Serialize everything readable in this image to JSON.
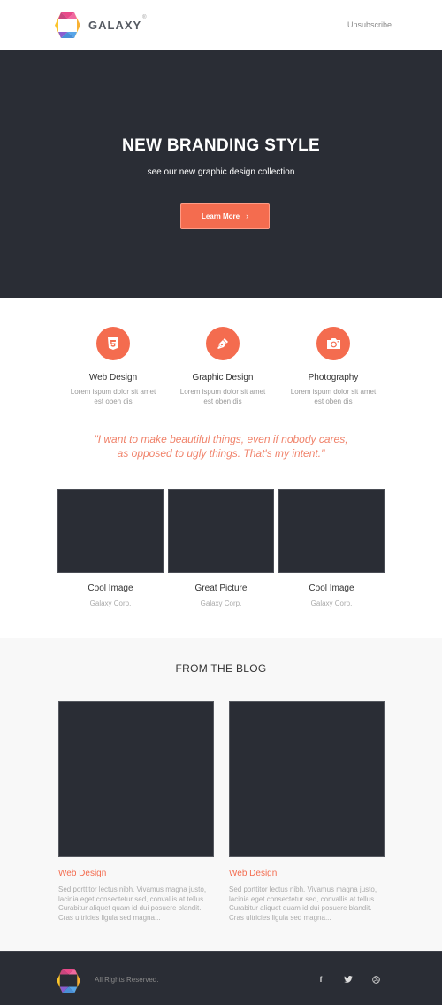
{
  "header": {
    "brand": "GALAXY",
    "brand_mark": "®",
    "unsubscribe_label": "Unsubscribe"
  },
  "hero": {
    "title": "NEW BRANDING STYLE",
    "subtitle": "see our new graphic design collection",
    "button_label": "Learn More",
    "button_icon": "chevron-right-icon",
    "chevron": "›"
  },
  "features": [
    {
      "icon": "html5-icon",
      "title": "Web Design",
      "desc_line1": "Lorem ispum dolor sit amet",
      "desc_line2": "est oben dis"
    },
    {
      "icon": "pen-nib-icon",
      "title": "Graphic Design",
      "desc_line1": "Lorem ispum dolor sit amet",
      "desc_line2": "est oben dis"
    },
    {
      "icon": "camera-icon",
      "title": "Photography",
      "desc_line1": "Lorem ispum dolor sit amet",
      "desc_line2": "est oben dis"
    }
  ],
  "quote": {
    "line1": "\"I want to make beautiful things, even if nobody cares,",
    "line2": "as opposed to ugly things. That's my intent.\""
  },
  "gallery": [
    {
      "title": "Cool Image",
      "subtitle": "Galaxy Corp."
    },
    {
      "title": "Great Picture",
      "subtitle": "Galaxy Corp."
    },
    {
      "title": "Cool Image",
      "subtitle": "Galaxy Corp."
    }
  ],
  "blog": {
    "title": "FROM THE BLOG",
    "posts": [
      {
        "title": "Web Design",
        "line1": "Sed porttitor lectus nibh. Vivamus magna justo,",
        "line2": "lacinia eget consectetur sed, convallis at tellus.",
        "line3": "Curabitur aliquet quam id dui posuere blandit.",
        "line4": "Cras ultricies ligula sed magna..."
      },
      {
        "title": "Web Design",
        "line1": "Sed porttitor lectus nibh. Vivamus magna justo,",
        "line2": "lacinia eget consectetur sed, convallis at tellus.",
        "line3": "Curabitur aliquet quam id dui posuere blandit.",
        "line4": "Cras ultricies ligula sed magna..."
      }
    ]
  },
  "footer": {
    "rights": "All Rights Reserved.",
    "social": [
      {
        "icon": "facebook-icon",
        "glyph": "f"
      },
      {
        "icon": "twitter-icon",
        "glyph": ""
      },
      {
        "icon": "dribbble-icon",
        "glyph": ""
      }
    ]
  },
  "colors": {
    "accent": "#f46c4f",
    "dark": "#2a2d35",
    "light_bg": "#f8f8f8",
    "quote": "#f0826a"
  }
}
